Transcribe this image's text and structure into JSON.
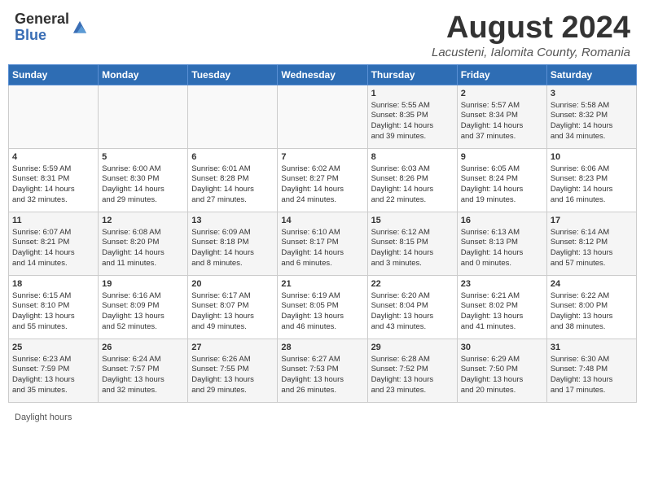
{
  "header": {
    "logo_general": "General",
    "logo_blue": "Blue",
    "month_title": "August 2024",
    "location": "Lacusteni, Ialomita County, Romania"
  },
  "days_of_week": [
    "Sunday",
    "Monday",
    "Tuesday",
    "Wednesday",
    "Thursday",
    "Friday",
    "Saturday"
  ],
  "footer": {
    "daylight_label": "Daylight hours"
  },
  "weeks": [
    [
      {
        "day": "",
        "content": ""
      },
      {
        "day": "",
        "content": ""
      },
      {
        "day": "",
        "content": ""
      },
      {
        "day": "",
        "content": ""
      },
      {
        "day": "1",
        "content": "Sunrise: 5:55 AM\nSunset: 8:35 PM\nDaylight: 14 hours\nand 39 minutes."
      },
      {
        "day": "2",
        "content": "Sunrise: 5:57 AM\nSunset: 8:34 PM\nDaylight: 14 hours\nand 37 minutes."
      },
      {
        "day": "3",
        "content": "Sunrise: 5:58 AM\nSunset: 8:32 PM\nDaylight: 14 hours\nand 34 minutes."
      }
    ],
    [
      {
        "day": "4",
        "content": "Sunrise: 5:59 AM\nSunset: 8:31 PM\nDaylight: 14 hours\nand 32 minutes."
      },
      {
        "day": "5",
        "content": "Sunrise: 6:00 AM\nSunset: 8:30 PM\nDaylight: 14 hours\nand 29 minutes."
      },
      {
        "day": "6",
        "content": "Sunrise: 6:01 AM\nSunset: 8:28 PM\nDaylight: 14 hours\nand 27 minutes."
      },
      {
        "day": "7",
        "content": "Sunrise: 6:02 AM\nSunset: 8:27 PM\nDaylight: 14 hours\nand 24 minutes."
      },
      {
        "day": "8",
        "content": "Sunrise: 6:03 AM\nSunset: 8:26 PM\nDaylight: 14 hours\nand 22 minutes."
      },
      {
        "day": "9",
        "content": "Sunrise: 6:05 AM\nSunset: 8:24 PM\nDaylight: 14 hours\nand 19 minutes."
      },
      {
        "day": "10",
        "content": "Sunrise: 6:06 AM\nSunset: 8:23 PM\nDaylight: 14 hours\nand 16 minutes."
      }
    ],
    [
      {
        "day": "11",
        "content": "Sunrise: 6:07 AM\nSunset: 8:21 PM\nDaylight: 14 hours\nand 14 minutes."
      },
      {
        "day": "12",
        "content": "Sunrise: 6:08 AM\nSunset: 8:20 PM\nDaylight: 14 hours\nand 11 minutes."
      },
      {
        "day": "13",
        "content": "Sunrise: 6:09 AM\nSunset: 8:18 PM\nDaylight: 14 hours\nand 8 minutes."
      },
      {
        "day": "14",
        "content": "Sunrise: 6:10 AM\nSunset: 8:17 PM\nDaylight: 14 hours\nand 6 minutes."
      },
      {
        "day": "15",
        "content": "Sunrise: 6:12 AM\nSunset: 8:15 PM\nDaylight: 14 hours\nand 3 minutes."
      },
      {
        "day": "16",
        "content": "Sunrise: 6:13 AM\nSunset: 8:13 PM\nDaylight: 14 hours\nand 0 minutes."
      },
      {
        "day": "17",
        "content": "Sunrise: 6:14 AM\nSunset: 8:12 PM\nDaylight: 13 hours\nand 57 minutes."
      }
    ],
    [
      {
        "day": "18",
        "content": "Sunrise: 6:15 AM\nSunset: 8:10 PM\nDaylight: 13 hours\nand 55 minutes."
      },
      {
        "day": "19",
        "content": "Sunrise: 6:16 AM\nSunset: 8:09 PM\nDaylight: 13 hours\nand 52 minutes."
      },
      {
        "day": "20",
        "content": "Sunrise: 6:17 AM\nSunset: 8:07 PM\nDaylight: 13 hours\nand 49 minutes."
      },
      {
        "day": "21",
        "content": "Sunrise: 6:19 AM\nSunset: 8:05 PM\nDaylight: 13 hours\nand 46 minutes."
      },
      {
        "day": "22",
        "content": "Sunrise: 6:20 AM\nSunset: 8:04 PM\nDaylight: 13 hours\nand 43 minutes."
      },
      {
        "day": "23",
        "content": "Sunrise: 6:21 AM\nSunset: 8:02 PM\nDaylight: 13 hours\nand 41 minutes."
      },
      {
        "day": "24",
        "content": "Sunrise: 6:22 AM\nSunset: 8:00 PM\nDaylight: 13 hours\nand 38 minutes."
      }
    ],
    [
      {
        "day": "25",
        "content": "Sunrise: 6:23 AM\nSunset: 7:59 PM\nDaylight: 13 hours\nand 35 minutes."
      },
      {
        "day": "26",
        "content": "Sunrise: 6:24 AM\nSunset: 7:57 PM\nDaylight: 13 hours\nand 32 minutes."
      },
      {
        "day": "27",
        "content": "Sunrise: 6:26 AM\nSunset: 7:55 PM\nDaylight: 13 hours\nand 29 minutes."
      },
      {
        "day": "28",
        "content": "Sunrise: 6:27 AM\nSunset: 7:53 PM\nDaylight: 13 hours\nand 26 minutes."
      },
      {
        "day": "29",
        "content": "Sunrise: 6:28 AM\nSunset: 7:52 PM\nDaylight: 13 hours\nand 23 minutes."
      },
      {
        "day": "30",
        "content": "Sunrise: 6:29 AM\nSunset: 7:50 PM\nDaylight: 13 hours\nand 20 minutes."
      },
      {
        "day": "31",
        "content": "Sunrise: 6:30 AM\nSunset: 7:48 PM\nDaylight: 13 hours\nand 17 minutes."
      }
    ]
  ]
}
